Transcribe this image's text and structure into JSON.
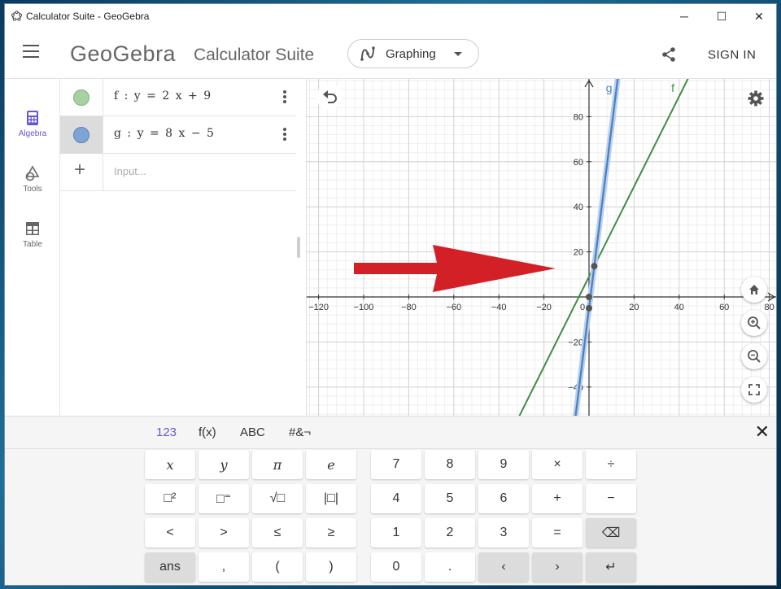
{
  "window": {
    "title": "Calculator Suite - GeoGebra",
    "minimize": "─",
    "maximize": "☐",
    "close": "✕"
  },
  "header": {
    "logo": "GeoGebra",
    "suite": "Calculator Suite",
    "app_switch_label": "Graphing",
    "signin": "SIGN IN"
  },
  "sidenav": {
    "algebra": "Algebra",
    "tools": "Tools",
    "table": "Table"
  },
  "algebra": {
    "rows": [
      {
        "expr": "f : y = 2 x + 9",
        "color": "#a5d1a3"
      },
      {
        "expr": "g : y = 8 x − 5",
        "color": "#7ea4d6"
      }
    ],
    "input_placeholder": "Input..."
  },
  "graph": {
    "x_ticks": [
      "−120",
      "−100",
      "−80",
      "−60",
      "−40",
      "−20",
      "0",
      "20",
      "40",
      "60",
      "80"
    ],
    "y_ticks": [
      "80",
      "60",
      "40",
      "20",
      "−20",
      "−40"
    ],
    "labels": {
      "g": "g",
      "f": "f"
    },
    "colors": {
      "f": "#3e8e41",
      "g": "#4a7fc3",
      "arrow": "#d32027"
    }
  },
  "keyboard": {
    "tabs": [
      "123",
      "f(x)",
      "ABC",
      "#&¬"
    ],
    "close": "✕",
    "left_keys": [
      [
        "x",
        "y",
        "π",
        "e"
      ],
      [
        "□²",
        "□⁼",
        "√□",
        "|□|"
      ],
      [
        "<",
        ">",
        "≤",
        "≥"
      ],
      [
        "ans",
        ",",
        "(",
        ")"
      ]
    ],
    "right_keys": [
      [
        "7",
        "8",
        "9",
        "×",
        "÷"
      ],
      [
        "4",
        "5",
        "6",
        "+",
        "−"
      ],
      [
        "1",
        "2",
        "3",
        "=",
        "⌫"
      ],
      [
        "0",
        ".",
        "‹",
        "›",
        "↵"
      ]
    ]
  }
}
